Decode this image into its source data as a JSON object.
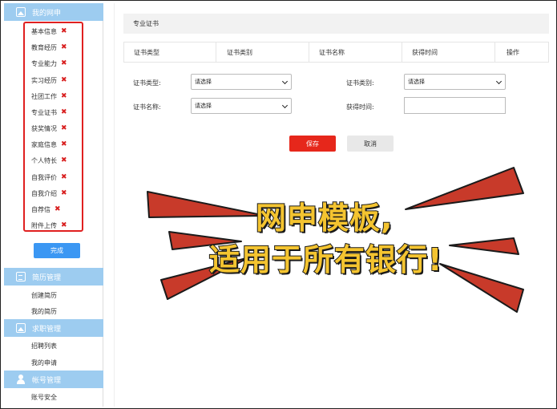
{
  "sidebar": {
    "section1": {
      "title": "我的网申"
    },
    "items": [
      {
        "label": "基本信息",
        "status": "✖"
      },
      {
        "label": "教育经历",
        "status": "✖"
      },
      {
        "label": "专业能力",
        "status": "✖"
      },
      {
        "label": "实习经历",
        "status": "✖"
      },
      {
        "label": "社团工作",
        "status": "✖"
      },
      {
        "label": "专业证书",
        "status": "✖"
      },
      {
        "label": "获奖情况",
        "status": "✖"
      },
      {
        "label": "家庭信息",
        "status": "✖"
      },
      {
        "label": "个人特长",
        "status": "✖"
      },
      {
        "label": "自我评价",
        "status": "✖"
      },
      {
        "label": "自我介绍",
        "status": "✖"
      },
      {
        "label": "自荐信",
        "status": "✖"
      },
      {
        "label": "附件上传",
        "status": "✖"
      }
    ],
    "done_label": "完成",
    "section2": {
      "title": "简历管理",
      "items": [
        "创建简历",
        "我的简历"
      ]
    },
    "section3": {
      "title": "求职管理",
      "items": [
        "招聘列表",
        "我的申请"
      ]
    },
    "section4": {
      "title": "帐号管理",
      "items": [
        "账号安全"
      ]
    }
  },
  "main": {
    "panel_title": "专业证书",
    "table_headers": [
      "证书类型",
      "证书类别",
      "证书名称",
      "获得时间",
      "操作"
    ],
    "form": {
      "cert_type_label": "证书类型:",
      "cert_type_value": "请选择",
      "cert_category_label": "证书类别:",
      "cert_category_value": "请选择",
      "cert_name_label": "证书名称:",
      "cert_name_value": "请选择",
      "obtain_time_label": "获得时间:",
      "obtain_time_value": ""
    },
    "save_label": "保存",
    "cancel_label": "取消"
  },
  "banner": {
    "line1": "网申模板,",
    "line2": "适用于所有银行!"
  },
  "colors": {
    "section_bg": "#9dccf0",
    "save_bg": "#e6271b",
    "done_bg": "#3b97f3",
    "status_x": "#d81e1e",
    "banner_text": "#f4c430",
    "burst_red": "#c83a2a"
  }
}
